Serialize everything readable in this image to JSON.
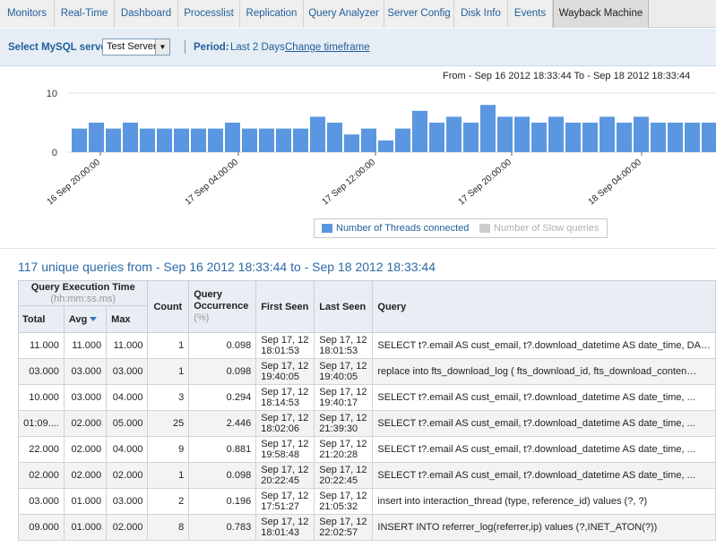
{
  "tabs": [
    {
      "label": "Monitors",
      "name": "tab-monitors"
    },
    {
      "label": "Real-Time",
      "name": "tab-real-time"
    },
    {
      "label": "Dashboard",
      "name": "tab-dashboard"
    },
    {
      "label": "Processlist",
      "name": "tab-processlist"
    },
    {
      "label": "Replication",
      "name": "tab-replication"
    },
    {
      "label": "Query Analyzer",
      "name": "tab-query-analyzer"
    },
    {
      "label": "Server Config",
      "name": "tab-server-config"
    },
    {
      "label": "Disk Info",
      "name": "tab-disk-info"
    },
    {
      "label": "Events",
      "name": "tab-events"
    },
    {
      "label": "Wayback Machine",
      "name": "tab-wayback-machine",
      "active": true
    }
  ],
  "toolbar": {
    "server_label": "Select MySQL server",
    "server_value": "Test Server",
    "period_label": "Period:",
    "period_value": "Last 2 Days",
    "change_link": "Change timeframe"
  },
  "range_text": "From - Sep 16 2012 18:33:44   To - Sep 18 2012 18:33:44",
  "chart_data": {
    "type": "bar",
    "ylim": [
      0,
      10
    ],
    "yticks": [
      0,
      10
    ],
    "xtick_labels": [
      "16 Sep 20:00:00",
      "17 Sep 04:00:00",
      "17 Sep 12:00:00",
      "17 Sep 20:00:00",
      "18 Sep 04:00:00"
    ],
    "series": [
      {
        "name": "Number of Threads connected",
        "color": "#5b97e0",
        "values": [
          4,
          5,
          4,
          5,
          4,
          4,
          4,
          4,
          4,
          5,
          4,
          4,
          4,
          4,
          6,
          5,
          3,
          4,
          2,
          4,
          7,
          5,
          6,
          5,
          8,
          6,
          6,
          5,
          6,
          5,
          5,
          6,
          5,
          6,
          5,
          5,
          5,
          5
        ]
      },
      {
        "name": "Number of Slow queries",
        "color": "#cccccc",
        "values": []
      }
    ]
  },
  "heading": "117 unique queries from - Sep 16 2012 18:33:44 to - Sep 18 2012 18:33:44",
  "table": {
    "headers": {
      "qet": "Query Execution Time",
      "qet_unit": "(hh:mm:ss.ms)",
      "total": "Total",
      "avg": "Avg",
      "max": "Max",
      "count": "Count",
      "occ": "Query Occurrence",
      "occ_unit": "(%)",
      "first": "First Seen",
      "last": "Last Seen",
      "query": "Query"
    },
    "rows": [
      {
        "total": "11.000",
        "avg": "11.000",
        "max": "11.000",
        "count": "1",
        "occ": "0.098",
        "first": [
          "Sep 17, 12",
          "18:01:53"
        ],
        "last": [
          "Sep 17, 12",
          "18:01:53"
        ],
        "query": "SELECT t?.email AS cust_email, t?.download_datetime AS date_time, DA…"
      },
      {
        "total": "03.000",
        "avg": "03.000",
        "max": "03.000",
        "count": "1",
        "occ": "0.098",
        "first": [
          "Sep 17, 12",
          "19:40:05"
        ],
        "last": [
          "Sep 17, 12",
          "19:40:05"
        ],
        "query": "replace into fts_download_log ( fts_download_id, fts_download_conten…"
      },
      {
        "total": "10.000",
        "avg": "03.000",
        "max": "04.000",
        "count": "3",
        "occ": "0.294",
        "first": [
          "Sep 17, 12",
          "18:14:53"
        ],
        "last": [
          "Sep 17, 12",
          "19:40:17"
        ],
        "query": "SELECT t?.email AS cust_email, t?.download_datetime AS date_time, ..."
      },
      {
        "total": "01:09....",
        "avg": "02.000",
        "max": "05.000",
        "count": "25",
        "occ": "2.446",
        "first": [
          "Sep 17, 12",
          "18:02:06"
        ],
        "last": [
          "Sep 17, 12",
          "21:39:30"
        ],
        "query": "SELECT t?.email AS cust_email, t?.download_datetime AS date_time, ..."
      },
      {
        "total": "22.000",
        "avg": "02.000",
        "max": "04.000",
        "count": "9",
        "occ": "0.881",
        "first": [
          "Sep 17, 12",
          "19:58:48"
        ],
        "last": [
          "Sep 17, 12",
          "21:20:28"
        ],
        "query": "SELECT t?.email AS cust_email, t?.download_datetime AS date_time, ..."
      },
      {
        "total": "02.000",
        "avg": "02.000",
        "max": "02.000",
        "count": "1",
        "occ": "0.098",
        "first": [
          "Sep 17, 12",
          "20:22:45"
        ],
        "last": [
          "Sep 17, 12",
          "20:22:45"
        ],
        "query": "SELECT t?.email AS cust_email, t?.download_datetime AS date_time, ..."
      },
      {
        "total": "03.000",
        "avg": "01.000",
        "max": "03.000",
        "count": "2",
        "occ": "0.196",
        "first": [
          "Sep 17, 12",
          "17:51:27"
        ],
        "last": [
          "Sep 17, 12",
          "21:05:32"
        ],
        "query": "insert into interaction_thread (type, reference_id) values (?, ?)"
      },
      {
        "total": "09.000",
        "avg": "01.000",
        "max": "02.000",
        "count": "8",
        "occ": "0.783",
        "first": [
          "Sep 17, 12",
          "18:01:43"
        ],
        "last": [
          "Sep 17, 12",
          "22:02:57"
        ],
        "query": "INSERT INTO referrer_log(referrer,ip) values (?,INET_ATON(?))"
      }
    ]
  }
}
